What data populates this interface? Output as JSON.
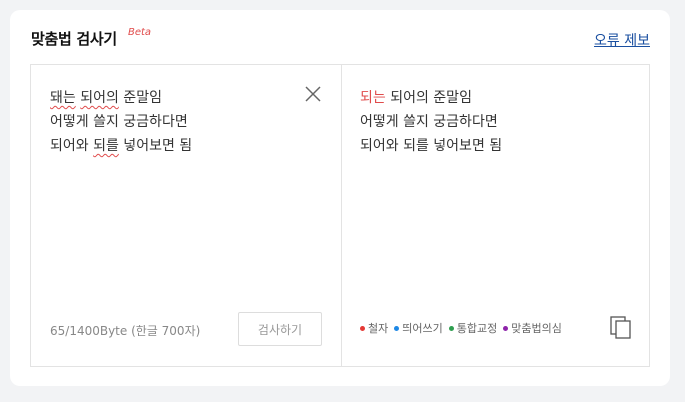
{
  "header": {
    "title": "맞춤법 검사기",
    "beta": "Beta",
    "report_link": "오류 제보"
  },
  "input": {
    "line1": {
      "err1": "돼는",
      "rest1": " ",
      "err2": "되어의",
      "rest2": " 준말임"
    },
    "line2": "어떻게 쓸지 궁금하다면",
    "line3": {
      "pre": "되어와 ",
      "err": "되를",
      "post": " 넣어보면 됨"
    },
    "byte_count": "65/1400Byte (한글 700자)",
    "check_button": "검사하기"
  },
  "result": {
    "line1": {
      "corrected": "되는",
      "rest": " 되어의 준말임"
    },
    "line2": "어떻게 쓸지 궁금하다면",
    "line3": "되어와 되를 넣어보면 됨"
  },
  "legend": [
    {
      "label": "철자",
      "color": "#e53935"
    },
    {
      "label": "띄어쓰기",
      "color": "#1e88e5"
    },
    {
      "label": "통합교정",
      "color": "#2e9e4f"
    },
    {
      "label": "맞춤법의심",
      "color": "#8e24aa"
    }
  ],
  "icons": {
    "clear": "close-icon",
    "copy": "copy-icon"
  }
}
